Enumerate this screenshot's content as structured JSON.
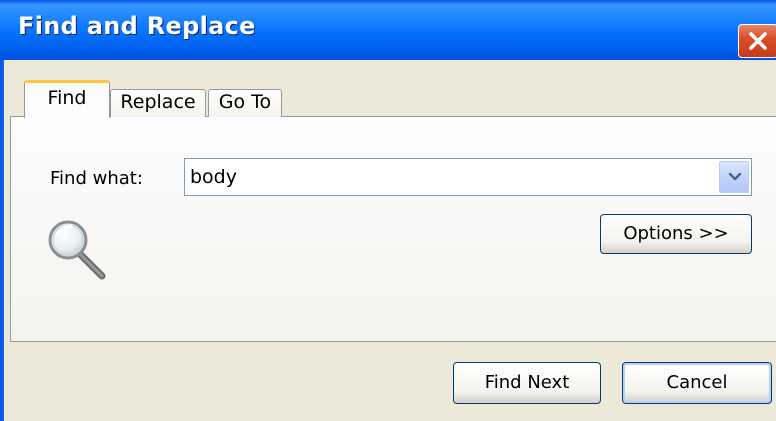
{
  "window": {
    "title": "Find and Replace"
  },
  "tabs": [
    {
      "label": "Find",
      "selected": true
    },
    {
      "label": "Replace",
      "selected": false
    },
    {
      "label": "Go To",
      "selected": false
    }
  ],
  "find": {
    "label": "Find what:",
    "value": "body"
  },
  "buttons": {
    "options": "Options >>",
    "find_next": "Find Next",
    "cancel": "Cancel"
  },
  "icons": {
    "close": "close-icon",
    "dropdown": "chevron-down-icon",
    "magnifier": "magnifier-icon"
  },
  "colors": {
    "titlebar": "#0054e3",
    "window_bg": "#ece9d8",
    "close_button": "#d8512c",
    "tab_highlight": "#ffc83c"
  }
}
